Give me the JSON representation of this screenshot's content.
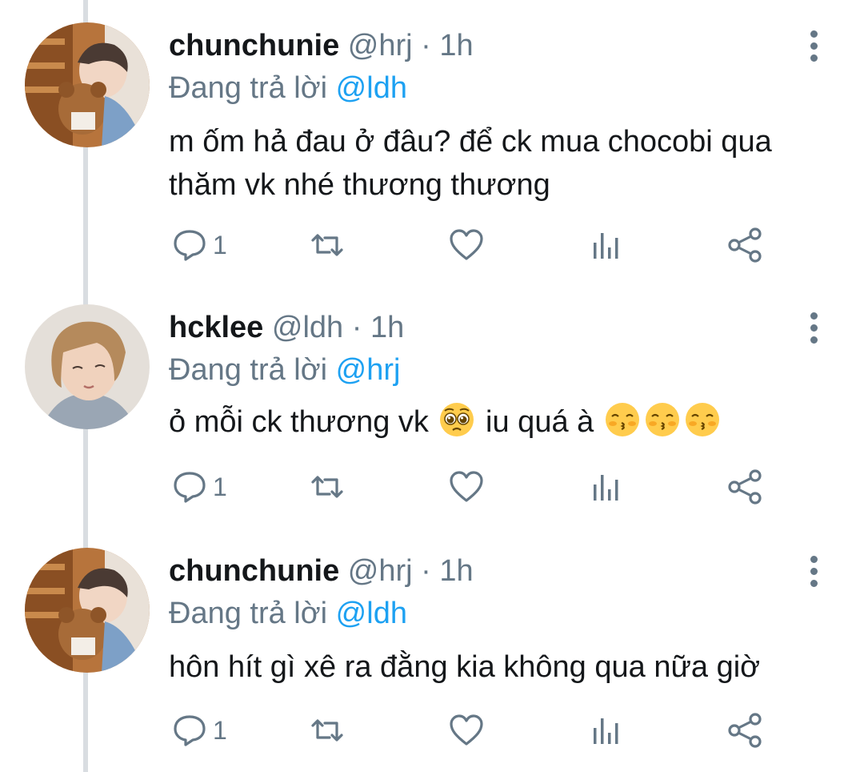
{
  "thread": {
    "tweets": [
      {
        "name": "chunchunie",
        "handle": "@hrj",
        "sep": " · ",
        "time": "1h",
        "replying_prefix": "Đang trả lời ",
        "replying_to": "@ldh",
        "text": "m ốm hả đau ở đâu? để ck mua chocobi qua thăm vk nhé thương thương",
        "reply_count": "1",
        "avatar_icon": "avatar-photo-bear"
      },
      {
        "name": "hcklee",
        "handle": "@ldh",
        "sep": " · ",
        "time": "1h",
        "replying_prefix": "Đang trả lời ",
        "replying_to": "@hrj",
        "text_before": "ỏ mỗi ck thương vk",
        "text_middle": "iu quá à",
        "emoji_1": "pleading-face",
        "emoji_2": "kissing-face",
        "reply_count": "1",
        "avatar_icon": "avatar-photo-portrait"
      },
      {
        "name": "chunchunie",
        "handle": "@hrj",
        "sep": " · ",
        "time": "1h",
        "replying_prefix": "Đang trả lời ",
        "replying_to": "@ldh",
        "text": "hôn hít gì xê ra đằng kia không qua nữa giờ",
        "reply_count": "1",
        "avatar_icon": "avatar-photo-bear"
      }
    ]
  },
  "colors": {
    "name": "#14171a",
    "meta": "#657786",
    "mention": "#1da1f2",
    "thread_line": "#d9dde1"
  }
}
